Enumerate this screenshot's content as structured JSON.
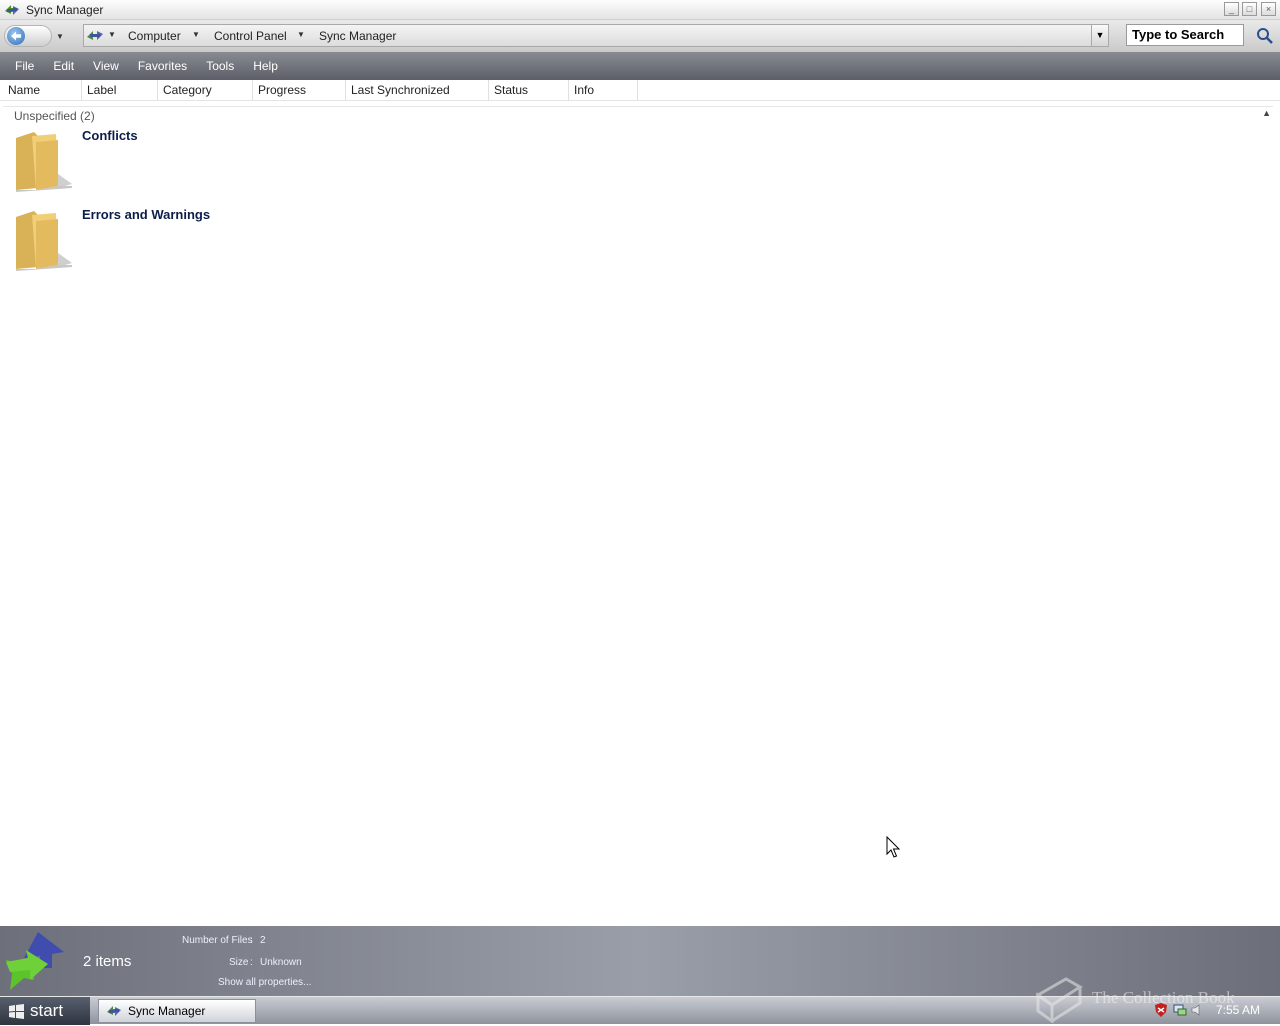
{
  "window": {
    "title": "Sync Manager",
    "controls": {
      "minimize": "_",
      "maximize": "□",
      "close": "×"
    },
    "app_icon": "sync-arrows-icon"
  },
  "address": {
    "crumbs": [
      "Computer",
      "Control Panel",
      "Sync Manager"
    ],
    "search_placeholder": "Type to Search"
  },
  "menu": [
    "File",
    "Edit",
    "View",
    "Favorites",
    "Tools",
    "Help"
  ],
  "columns": [
    "Name",
    "Label",
    "Category",
    "Progress",
    "Last Synchronized",
    "Status",
    "Info"
  ],
  "group": {
    "label": "Unspecified (2)"
  },
  "items": [
    {
      "name": "Conflicts",
      "icon": "folder-icon"
    },
    {
      "name": "Errors and Warnings",
      "icon": "folder-icon"
    }
  ],
  "details": {
    "count_label": "2 items",
    "files_label": "Number of Files",
    "files_value": "2",
    "size_label": "Size",
    "size_value": "Unknown",
    "show_all": "Show all properties..."
  },
  "taskbar": {
    "start_label": "start",
    "task_label": "Sync Manager",
    "clock": "7:55 AM"
  },
  "watermark": {
    "text": "The Collection Book"
  },
  "colors": {
    "menubar": "#767881",
    "item_name": "#0b1e4a",
    "folder": "#e9c66b"
  }
}
